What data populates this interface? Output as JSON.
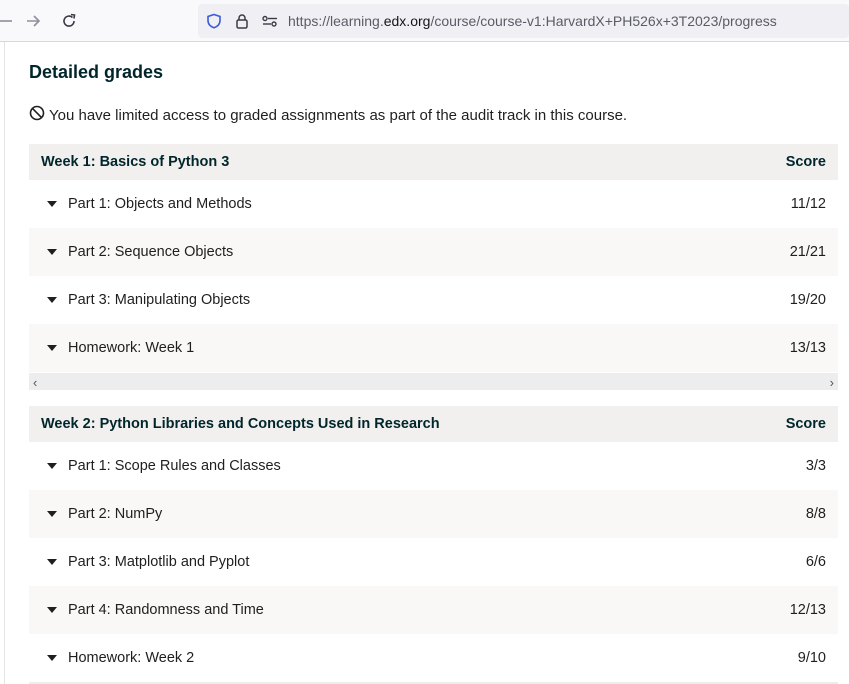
{
  "browser": {
    "url_prefix": "https://learning.",
    "url_host": "edx.org",
    "url_path": "/course/course-v1:HarvardX+PH526x+3T2023/progress",
    "icons": [
      "back-arrow-icon",
      "forward-arrow-icon",
      "reload-icon",
      "shield-icon",
      "lock-icon",
      "permissions-icon"
    ]
  },
  "page": {
    "title": "Detailed grades",
    "notice": "You have limited access to graded assignments as part of the audit track in this course."
  },
  "sections": [
    {
      "title": "Week 1: Basics of Python 3",
      "score_header": "Score",
      "rows": [
        {
          "label": "Part 1: Objects and Methods",
          "score": "11/12"
        },
        {
          "label": "Part 2: Sequence Objects",
          "score": "21/21"
        },
        {
          "label": "Part 3: Manipulating Objects",
          "score": "19/20"
        },
        {
          "label": "Homework: Week 1",
          "score": "13/13"
        }
      ]
    },
    {
      "title": "Week 2: Python Libraries and Concepts Used in Research",
      "score_header": "Score",
      "rows": [
        {
          "label": "Part 1: Scope Rules and Classes",
          "score": "3/3"
        },
        {
          "label": "Part 2: NumPy",
          "score": "8/8"
        },
        {
          "label": "Part 3: Matplotlib and Pyplot",
          "score": "6/6"
        },
        {
          "label": "Part 4: Randomness and Time",
          "score": "12/13"
        },
        {
          "label": "Homework: Week 2",
          "score": "9/10"
        }
      ]
    }
  ],
  "colors": {
    "heading": "#00262b",
    "row_alt": "#f9f8f7",
    "header_bg": "#f2f0ef"
  }
}
